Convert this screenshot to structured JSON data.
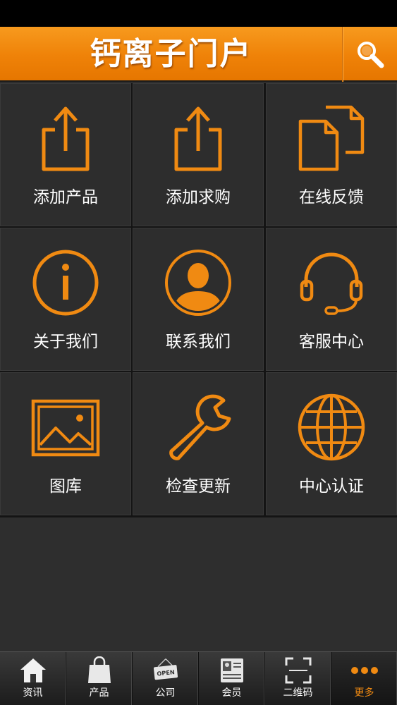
{
  "header": {
    "title": "钙离子门户"
  },
  "grid": {
    "items": [
      {
        "label": "添加产品",
        "icon": "share-upload-icon"
      },
      {
        "label": "添加求购",
        "icon": "share-upload-icon"
      },
      {
        "label": "在线反馈",
        "icon": "documents-icon"
      },
      {
        "label": "关于我们",
        "icon": "info-icon"
      },
      {
        "label": "联系我们",
        "icon": "person-icon"
      },
      {
        "label": "客服中心",
        "icon": "headset-icon"
      },
      {
        "label": "图库",
        "icon": "picture-icon"
      },
      {
        "label": "检查更新",
        "icon": "wrench-icon"
      },
      {
        "label": "中心认证",
        "icon": "globe-icon"
      }
    ]
  },
  "tabbar": {
    "tabs": [
      {
        "label": "资讯",
        "icon": "home-icon"
      },
      {
        "label": "产品",
        "icon": "shopping-bag-icon"
      },
      {
        "label": "公司",
        "icon": "open-sign-icon",
        "badge_text": "OPEN"
      },
      {
        "label": "会员",
        "icon": "member-card-icon"
      },
      {
        "label": "二维码",
        "icon": "qr-scan-icon"
      },
      {
        "label": "更多",
        "icon": "more-dots-icon"
      }
    ],
    "active_index": 5
  },
  "colors": {
    "accent": "#f08a12",
    "background": "#2e2e2e",
    "header": "#ef8208"
  }
}
